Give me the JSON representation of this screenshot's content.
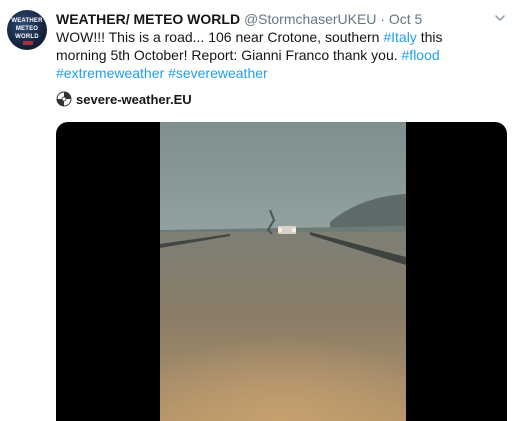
{
  "tweet": {
    "author_name": "WEATHER/ METEO WORLD",
    "handle": "@StormchaserUKEU",
    "separator": "·",
    "timestamp": "Oct 5",
    "body_parts": [
      {
        "text": "WOW!!! This is a road... 106 near Crotone, southern ",
        "link": false
      },
      {
        "text": "#Italy",
        "link": true
      },
      {
        "text": " this morning 5th October! Report: Gianni Franco  thank you. ",
        "link": false
      },
      {
        "text": "#flood",
        "link": true
      },
      {
        "text": " ",
        "link": false
      },
      {
        "text": "#extremeweather",
        "link": true
      },
      {
        "text": " ",
        "link": false
      },
      {
        "text": "#severeweather",
        "link": true
      }
    ],
    "source_name": "severe-weather.EU",
    "avatar_text": [
      "WEATHER",
      "METEO",
      "WORLD"
    ]
  },
  "colors": {
    "link": "#1da1f2",
    "secondary_text": "#657786",
    "primary_text": "#14171a"
  },
  "icons": {
    "chevron": "chevron-down-icon",
    "source": "severe-weather-logo-icon"
  },
  "media": {
    "type": "video",
    "description_icon": "flooded-road-video-frame"
  }
}
